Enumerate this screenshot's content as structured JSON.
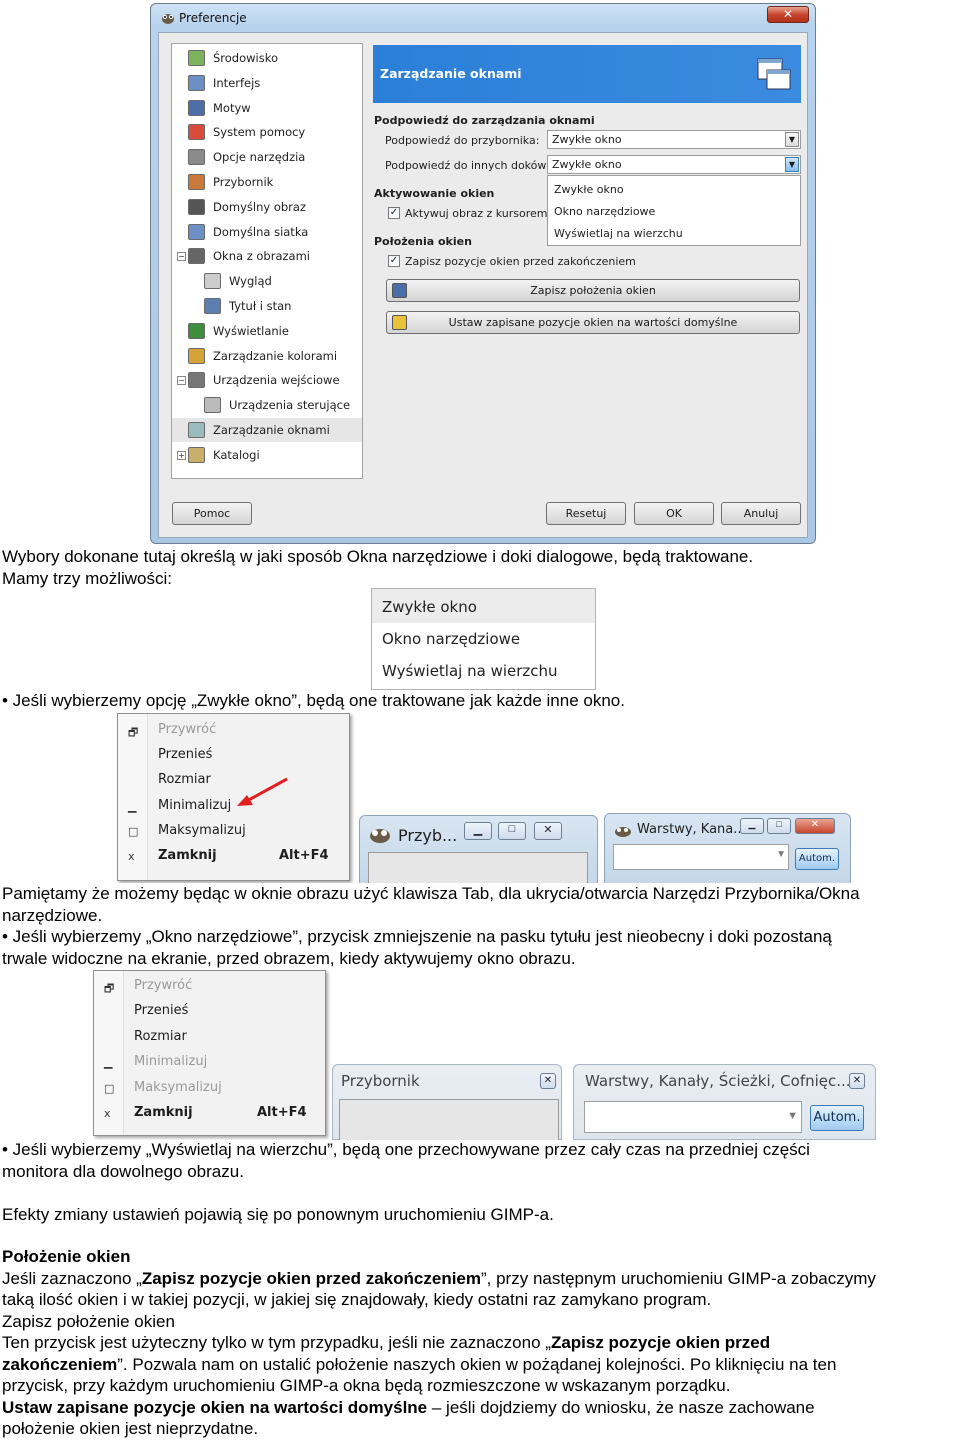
{
  "prefs_window": {
    "title": "Preferencje",
    "close_symbol": "✕",
    "tree_items": [
      {
        "label": "Środowisko",
        "icon": "environment-icon",
        "indent": 0
      },
      {
        "label": "Interfejs",
        "icon": "interface-icon",
        "indent": 0
      },
      {
        "label": "Motyw",
        "icon": "theme-icon",
        "indent": 0
      },
      {
        "label": "System pomocy",
        "icon": "help-system-icon",
        "indent": 0
      },
      {
        "label": "Opcje narzędzia",
        "icon": "tool-options-icon",
        "indent": 0
      },
      {
        "label": "Przybornik",
        "icon": "toolbox-icon",
        "indent": 0
      },
      {
        "label": "Domyślny obraz",
        "icon": "default-image-icon",
        "indent": 0
      },
      {
        "label": "Domyślna siatka",
        "icon": "default-grid-icon",
        "indent": 0
      },
      {
        "label": "Okna z obrazami",
        "icon": "image-windows-icon",
        "indent": 0,
        "expander": "−"
      },
      {
        "label": "Wygląd",
        "icon": "appearance-icon",
        "indent": 1
      },
      {
        "label": "Tytuł i stan",
        "icon": "title-status-icon",
        "indent": 1
      },
      {
        "label": "Wyświetlanie",
        "icon": "display-icon",
        "indent": 0
      },
      {
        "label": "Zarządzanie kolorami",
        "icon": "color-management-icon",
        "indent": 0
      },
      {
        "label": "Urządzenia wejściowe",
        "icon": "input-devices-icon",
        "indent": 0,
        "expander": "−"
      },
      {
        "label": "Urządzenia sterujące",
        "icon": "input-controllers-icon",
        "indent": 1
      },
      {
        "label": "Zarządzanie oknami",
        "icon": "window-management-icon",
        "indent": 0,
        "selected": true
      },
      {
        "label": "Katalogi",
        "icon": "folders-icon",
        "indent": 0,
        "expander": "+"
      }
    ],
    "banner_title": "Zarządzanie oknami",
    "section_hints": "Podpowiedź do zarządzania oknami",
    "hint_toolbox_label": "Podpowiedź do przybornika:",
    "hint_toolbox_value": "Zwykłe okno",
    "hint_docks_label": "Podpowiedź do innych doków:",
    "hint_docks_value": "Zwykłe okno",
    "dropdown_options": [
      "Zwykłe okno",
      "Okno narzędziowe",
      "Wyświetlaj na wierzchu"
    ],
    "section_focus": "Aktywowanie okien",
    "focus_checkbox_label": "Aktywuj obraz z kursorem",
    "focus_checkbox_checked": true,
    "section_positions": "Położenia okien",
    "save_positions_checkbox_label": "Zapisz pozycje okien przed zakończeniem",
    "save_positions_checkbox_checked": true,
    "save_positions_button": "Zapisz położenia okien",
    "reset_positions_button": "Ustaw zapisane pozycje okien na wartości domyślne",
    "help_button": "Pomoc",
    "reset_button": "Resetuj",
    "ok_button": "OK",
    "cancel_button": "Anuluj",
    "check_mark": "✓"
  },
  "paragraphs": {
    "p1_line1": "Wybory dokonane tutaj określą w jaki sposób Okna narzędziowe i doki dialogowe, będą traktowane.",
    "p1_line2": "Mamy trzy możliwości:",
    "p2": "• Jeśli wybierzemy opcję „Zwykłe okno”, będą one traktowane jak każde inne okno.",
    "p3_line1": "Pamiętamy że możemy będąc w oknie obrazu użyć klawisza Tab, dla ukrycia/otwarcia Narzędzi Przybornika/Okna",
    "p3_line2": "narzędziowe.",
    "p4_line1": "• Jeśli wybierzemy „Okno narzędziowe”, przycisk zmniejszenie na pasku tytułu jest nieobecny i doki pozostaną",
    "p4_line2": "trwale widoczne na ekranie, przed obrazem, kiedy aktywujemy okno obrazu.",
    "p5_line1": "• Jeśli wybierzemy „Wyświetlaj na wierzchu”, będą one przechowywane przez cały czas na przedniej części",
    "p5_line2": "monitora dla dowolnego obrazu.",
    "p6": "Efekty zmiany ustawień pojawią się po ponownym uruchomieniu GIMP-a.",
    "h_positions": "Położenie okien",
    "p7_a": "Jeśli zaznaczono „",
    "p7_b": "Zapisz pozycje okien przed zakończeniem",
    "p7_c": "”, przy następnym uruchomieniu GIMP-a zobaczymy",
    "p7_line2": "taką ilość okien i w takiej pozycji, w jakiej się znajdowały, kiedy ostatni raz zamykano program.",
    "p8": "Zapisz położenie okien",
    "p9_a": "Ten przycisk jest użyteczny tylko w tym przypadku, jeśli nie zaznaczono „",
    "p9_b": "Zapisz pozycje okien przed",
    "p9_c": "zakończeniem",
    "p9_d": "”. Pozwala nam on ustalić położenie naszych okien w pożądanej kolejności. Po kliknięciu na ten",
    "p9_line3": "przycisk, przy każdym uruchomieniu GIMP-a okna będą rozmieszczone w wskazanym porządku.",
    "p10_a": "Ustaw zapisane pozycje okien na wartości domyślne",
    "p10_b": " – jeśli dojdziemy do wniosku, że nasze zachowane",
    "p10_line2": "położenie okien jest nieprzydatne."
  },
  "option_list_shot": {
    "items": [
      "Zwykłe okno",
      "Okno narzędziowe",
      "Wyświetlaj na wierzchu"
    ]
  },
  "sysmenu_normal": {
    "items": [
      {
        "label": "Przywróć",
        "symbol": "🗗",
        "disabled": true
      },
      {
        "label": "Przenieś",
        "symbol": "",
        "disabled": false
      },
      {
        "label": "Rozmiar",
        "symbol": "",
        "disabled": false
      },
      {
        "label": "Minimalizuj",
        "symbol": "▁",
        "disabled": false
      },
      {
        "label": "Maksymalizuj",
        "symbol": "□",
        "disabled": false
      },
      {
        "label": "Zamknij",
        "symbol": "x",
        "disabled": false,
        "bold": true,
        "accel": "Alt+F4"
      }
    ],
    "toolbox_title": "Przyb...",
    "layers_title": "Warstwy, Kana...",
    "auto_button": "Autom."
  },
  "sysmenu_utility": {
    "items": [
      {
        "label": "Przywróć",
        "symbol": "🗗",
        "disabled": true
      },
      {
        "label": "Przenieś",
        "symbol": "",
        "disabled": false
      },
      {
        "label": "Rozmiar",
        "symbol": "",
        "disabled": false
      },
      {
        "label": "Minimalizuj",
        "symbol": "▁",
        "disabled": true
      },
      {
        "label": "Maksymalizuj",
        "symbol": "□",
        "disabled": true
      },
      {
        "label": "Zamknij",
        "symbol": "x",
        "disabled": false,
        "bold": true,
        "accel": "Alt+F4"
      }
    ],
    "toolbox_title": "Przybornik",
    "layers_title": "Warstwy, Kanały, Ścieżki, Cofnięc...",
    "auto_button": "Autom."
  },
  "colors": {
    "banner_blue": "#2c7fd7",
    "close_red": "#c7452c",
    "arrow_red": "#e02020"
  }
}
